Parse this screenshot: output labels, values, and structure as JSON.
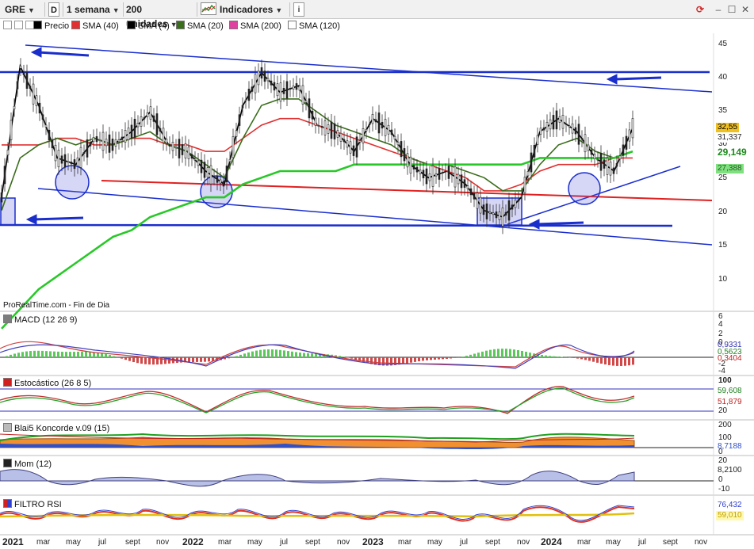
{
  "toolbar": {
    "ticker": "GRE",
    "d_button": "D",
    "period": "1 semana",
    "units": "200 unidades",
    "indicators": "Indicadores",
    "info": "i"
  },
  "legend": [
    {
      "label": "Precio",
      "color": "#000000"
    },
    {
      "label": "SMA (40)",
      "color": "#e03030"
    },
    {
      "label": "SMA (4)",
      "color": "#000000"
    },
    {
      "label": "SMA (20)",
      "color": "#3a6d1c"
    },
    {
      "label": "SMA (200)",
      "color": "#e040a0"
    },
    {
      "label": "SMA (120)",
      "color": "#ffffff"
    }
  ],
  "footer": "ProRealTime.com - Fin de Dia",
  "price_axis": {
    "ticks": [
      "45",
      "40",
      "35",
      "30",
      "25",
      "20",
      "15",
      "10"
    ]
  },
  "price_badges": {
    "last": "32,55",
    "b1": "31,337",
    "b2": "29,149",
    "b3": "27,388"
  },
  "panels": {
    "macd": {
      "label": "MACD (12 26 9)",
      "ticks": [
        "6",
        "4",
        "2",
        "0",
        "-2",
        "-4"
      ],
      "b1": "0,9331",
      "b2": "0,5623",
      "b3": "0,3404"
    },
    "stoch": {
      "label": "Estocástico (26 8 5)",
      "ticks": [
        "100",
        "20"
      ],
      "b1": "59,608",
      "b2": "51,879"
    },
    "koncorde": {
      "label": "Blai5 Koncorde v.09 (15)",
      "ticks": [
        "200",
        "100",
        "0"
      ],
      "b1": "8,7188"
    },
    "mom": {
      "label": "Mom (12)",
      "ticks": [
        "20",
        "0",
        "-10"
      ],
      "b1": "8,2100"
    },
    "rsi": {
      "label": "FILTRO RSI",
      "b1": "76,432",
      "b2": "59,010"
    }
  },
  "x_axis": [
    {
      "label": "2021",
      "year": true
    },
    {
      "label": "mar"
    },
    {
      "label": "may"
    },
    {
      "label": "jul"
    },
    {
      "label": "sept"
    },
    {
      "label": "nov"
    },
    {
      "label": "2022",
      "year": true
    },
    {
      "label": "mar"
    },
    {
      "label": "may"
    },
    {
      "label": "jul"
    },
    {
      "label": "sept"
    },
    {
      "label": "nov"
    },
    {
      "label": "2023",
      "year": true
    },
    {
      "label": "mar"
    },
    {
      "label": "may"
    },
    {
      "label": "jul"
    },
    {
      "label": "sept"
    },
    {
      "label": "nov"
    },
    {
      "label": "2024",
      "year": true
    },
    {
      "label": "mar"
    },
    {
      "label": "may"
    },
    {
      "label": "jul"
    },
    {
      "label": "sept"
    },
    {
      "label": "nov"
    }
  ],
  "chart_data": {
    "type": "line",
    "series": [
      {
        "name": "Precio",
        "values": [
          22,
          42,
          36,
          28,
          27,
          31,
          30,
          32,
          35,
          30,
          29,
          26,
          24,
          36,
          41,
          38,
          39,
          33,
          32,
          29,
          34,
          32,
          27,
          25,
          26,
          24,
          20,
          19,
          22,
          32,
          34,
          32,
          28,
          26,
          32.55
        ]
      },
      {
        "name": "SMA (40)",
        "values": [
          30,
          30,
          30,
          31,
          31,
          30,
          30,
          31,
          31,
          30,
          30,
          29,
          29,
          31,
          33,
          34,
          34,
          33,
          32,
          31,
          30,
          29,
          28,
          27,
          26,
          25,
          23,
          23,
          24,
          26,
          27,
          27,
          27,
          28,
          28
        ]
      },
      {
        "name": "SMA (20)",
        "values": [
          20,
          28,
          30,
          31,
          30,
          31,
          30,
          31,
          32,
          30,
          29,
          27,
          25,
          31,
          36,
          37,
          37,
          35,
          33,
          32,
          31,
          30,
          28,
          27,
          27,
          26,
          25,
          23,
          23,
          27,
          30,
          31,
          29,
          28,
          29
        ]
      },
      {
        "name": "SMA (200)",
        "values": [
          2,
          5,
          8,
          10,
          12,
          14,
          16,
          17,
          19,
          20,
          21,
          22,
          22,
          24,
          25,
          26,
          26,
          26,
          26,
          27,
          27,
          27,
          27,
          27,
          27,
          27,
          27,
          27,
          27,
          28,
          28,
          28,
          28,
          28,
          29
        ]
      }
    ],
    "ylim": [
      5,
      47
    ]
  }
}
